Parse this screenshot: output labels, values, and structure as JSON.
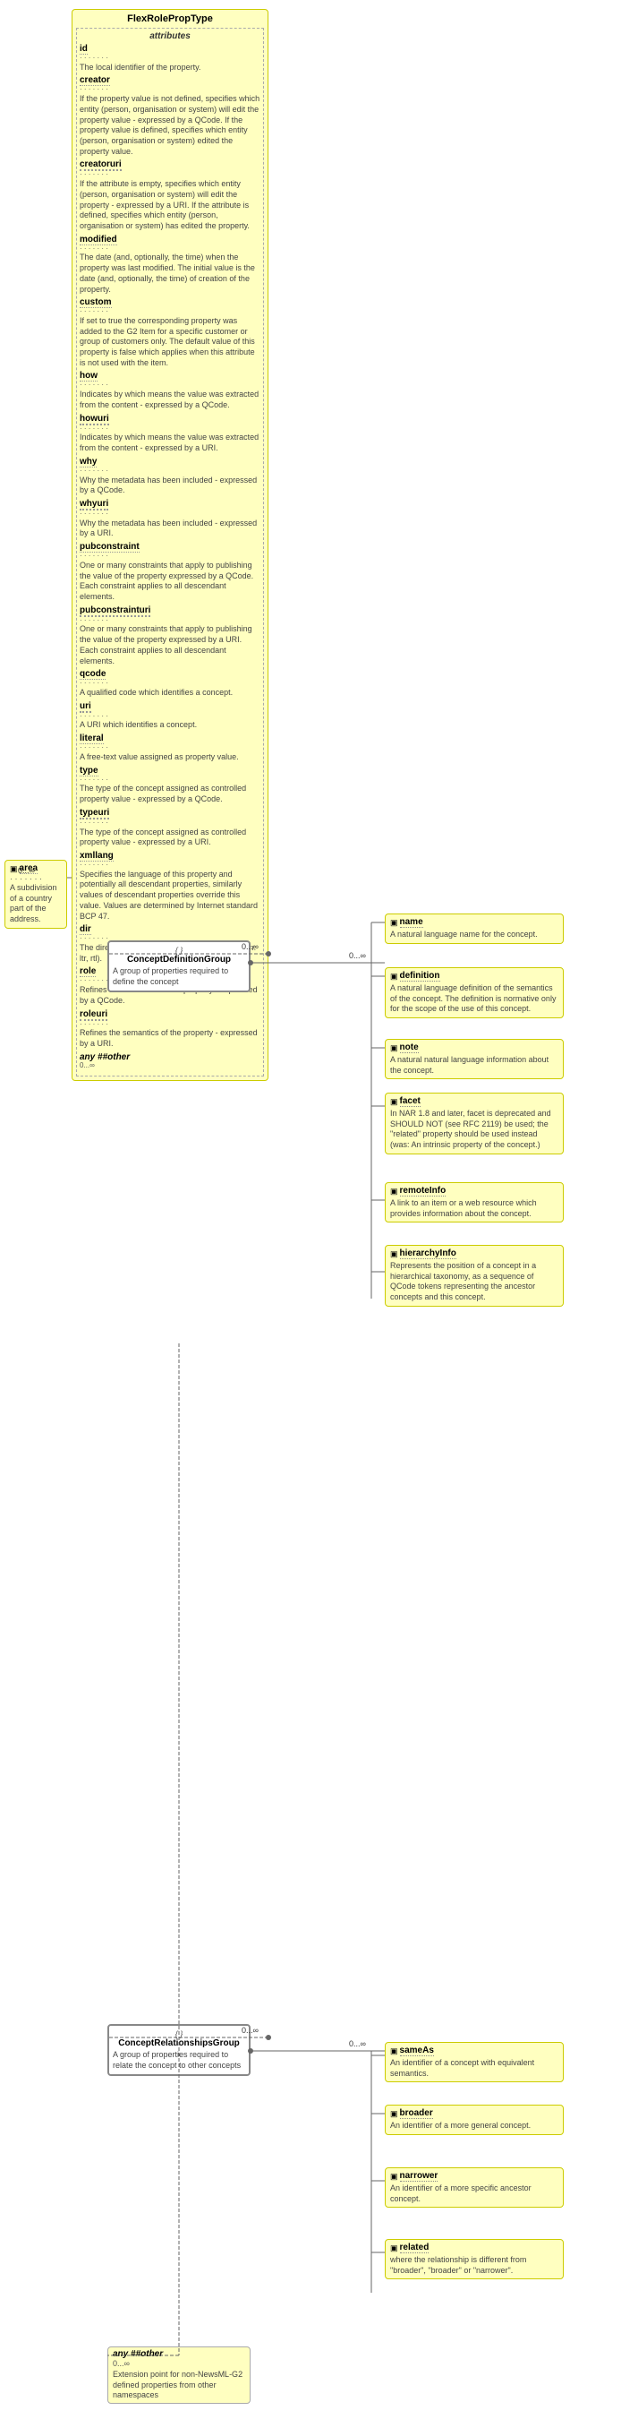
{
  "title": "FlexRolePropType",
  "attributes_label": "attributes",
  "attributes": [
    {
      "name": "id",
      "name_style": "normal",
      "dots": "▲▲▲▲▲▲▲",
      "desc": "The local identifier of the property."
    },
    {
      "name": "creator",
      "name_style": "normal",
      "dots": "▲▲▲▲▲▲▲",
      "desc": "If the property value is not defined, specifies which entity (person, organisation or system) will edit the property value - expressed by a QCode. If the property value is defined, specifies which entity (person, organisation or system) edited the property value."
    },
    {
      "name": "creatoruri",
      "name_style": "uri",
      "dots": "▲▲▲▲▲▲▲",
      "desc": "If the attribute is empty, specifies which entity (person, organisation or system) will edit the property - expressed by a URI. If the attribute is defined, specifies which entity (person, organisation or system) has edited the property."
    },
    {
      "name": "modified",
      "name_style": "normal",
      "dots": "▲▲▲▲▲▲▲",
      "desc": "The date (and, optionally, the time) when the property was last modified. The initial value is the date (and, optionally, the time) of creation of the property."
    },
    {
      "name": "custom",
      "name_style": "normal",
      "dots": "▲▲▲▲▲▲▲",
      "desc": "If set to true the corresponding property was added to the G2 Item for a specific customer or group of customers only. The default value of this property is false which applies when this attribute is not used with the item."
    },
    {
      "name": "how",
      "name_style": "normal",
      "dots": "▲▲▲▲▲▲▲",
      "desc": "Indicates by which means the value was extracted from the content - expressed by a QCode."
    },
    {
      "name": "howuri",
      "name_style": "uri",
      "dots": "▲▲▲▲▲▲▲",
      "desc": "Indicates by which means the value was extracted from the content - expressed by a URI."
    },
    {
      "name": "why",
      "name_style": "normal",
      "dots": "▲▲▲▲▲▲▲",
      "desc": "Why the metadata has been included - expressed by a QCode."
    },
    {
      "name": "whyuri",
      "name_style": "uri",
      "dots": "▲▲▲▲▲▲▲",
      "desc": "Why the metadata has been included - expressed by a URI."
    },
    {
      "name": "pubconstraint",
      "name_style": "normal",
      "dots": "▲▲▲▲▲▲▲",
      "desc": "One or many constraints that apply to publishing the value of the property expressed by a QCode. Each constraint applies to all descendant elements."
    },
    {
      "name": "pubconstrainturi",
      "name_style": "uri",
      "dots": "▲▲▲▲▲▲▲",
      "desc": "One or many constraints that apply to publishing the value of the property expressed by a URI. Each constraint applies to all descendant elements."
    },
    {
      "name": "qcode",
      "name_style": "normal",
      "dots": "▲▲▲▲▲▲▲",
      "desc": "A qualified code which identifies a concept."
    },
    {
      "name": "uri",
      "name_style": "uri",
      "dots": "▲▲▲▲▲▲▲",
      "desc": "A URI which identifies a concept."
    },
    {
      "name": "literal",
      "name_style": "normal",
      "dots": "▲▲▲▲▲▲▲",
      "desc": "A free-text value assigned as property value."
    },
    {
      "name": "type",
      "name_style": "normal",
      "dots": "▲▲▲▲▲▲▲",
      "desc": "The type of the concept assigned as controlled property value - expressed by a QCode."
    },
    {
      "name": "typeuri",
      "name_style": "uri",
      "dots": "▲▲▲▲▲▲▲",
      "desc": "The type of the concept assigned as controlled property value - expressed by a URI."
    },
    {
      "name": "xmllang",
      "name_style": "normal",
      "dots": "▲▲▲▲▲▲▲",
      "desc": "Specifies the language of this property and potentially all descendant properties, similarly values of descendant properties override this value. Values are determined by Internet standard BCP 47."
    },
    {
      "name": "dir",
      "name_style": "normal",
      "dots": "▲▲▲▲▲▲▲",
      "desc": "The directionality of textual content (enumeration: ltr, rtl)."
    },
    {
      "name": "role",
      "name_style": "normal",
      "dots": "▲▲▲▲▲▲▲",
      "desc": "Refines the semantics of the property - expressed by a QCode."
    },
    {
      "name": "roleuri",
      "name_style": "uri",
      "dots": "▲▲▲▲▲▲▲",
      "desc": "Refines the semantics of the property - expressed by a URI."
    }
  ],
  "any_other_label": "any ##other",
  "any_other_dots": "0...∞",
  "left_area": {
    "name": "area",
    "icon": "▣",
    "dots": "0...∞",
    "desc": "A subdivision of a country part of the address."
  },
  "right_elements": [
    {
      "id": "name",
      "name": "name",
      "icon": "▣",
      "desc": "A natural language name for the concept."
    },
    {
      "id": "definition",
      "name": "definition",
      "icon": "▣",
      "desc": "A natural language definition of the semantics of the concept. The definition is normative only for the scope of the use of this concept."
    },
    {
      "id": "note",
      "name": "note",
      "icon": "▣",
      "desc": "A natural natural language information about the concept."
    },
    {
      "id": "facet",
      "name": "facet",
      "icon": "▣",
      "desc": "In NAR 1.8 and later, facet is deprecated and SHOULD NOT (see RFC 2119) be used; the \"related\" property should be used instead (was: An intrinsic property of the concept.)"
    },
    {
      "id": "remoteinfo",
      "name": "remoteInfo",
      "icon": "▣",
      "desc": "A link to an item or a web resource which provides information about the concept."
    },
    {
      "id": "hierarchyinfo",
      "name": "hierarchyInfo",
      "icon": "▣",
      "desc": "Represents the position of a concept in a hierarchical taxonomy, as a sequence of QCode tokens representing the ancestor concepts and this concept."
    },
    {
      "id": "sameas",
      "name": "sameAs",
      "icon": "▣",
      "desc": "An identifier of a concept with equivalent semantics."
    },
    {
      "id": "broader",
      "name": "broader",
      "icon": "▣",
      "desc": "An identifier of a more general concept."
    },
    {
      "id": "narrower",
      "name": "narrower",
      "icon": "▣",
      "desc": "An identifier of a more specific ancestor concept."
    },
    {
      "id": "related",
      "name": "related",
      "icon": "▣",
      "desc": "where the relationship is different from \"broader\", \"broader\" or \"narrower\"."
    }
  ],
  "concept_definition_group": {
    "label": "ConceptDefinitionGroup",
    "desc": "A group of properties required to define the concept",
    "multiplicity_left": "——●——",
    "multiplicity_right": "0...∞"
  },
  "concept_relationships_group": {
    "label": "ConceptRelationshipsGroup",
    "desc": "A group of properties required to relate the concept to other concepts",
    "multiplicity_left": "——●——",
    "multiplicity_right": "0...∞"
  },
  "bottom_any": {
    "label": "any ##other",
    "dots": "0...∞",
    "desc": "Extension point for non-NewsML-G2 defined properties from other namespaces"
  },
  "connector_labels": {
    "top_mult": "0...∞",
    "left_mult": "0...∞"
  }
}
